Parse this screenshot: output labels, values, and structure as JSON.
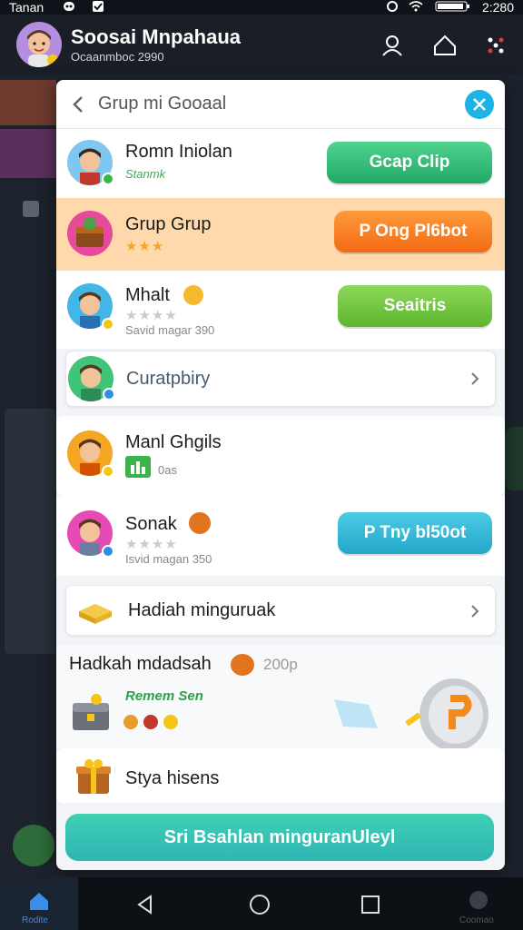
{
  "status_bar": {
    "carrier": "Tanan",
    "time": "2:280"
  },
  "header": {
    "app_title": "Soosai Mnpahaua",
    "subtitle": "Ocaanmboc 2990",
    "icons": [
      "user-icon",
      "home-icon",
      "more-dots-icon"
    ]
  },
  "modal": {
    "title": "Grup mi Gooaal",
    "rows": [
      {
        "name": "Romn Iniolan",
        "sub": "Stanmk",
        "button": "Gcap Clip"
      },
      {
        "name": "Grup Grup",
        "stars": "★★★",
        "button": "P Ong Pl6bot"
      },
      {
        "name": "Mhalt",
        "stars": "★★★★",
        "sub": "Savid magar 390",
        "button": "Seaitris"
      },
      {
        "name": "Curatpbiry"
      },
      {
        "name": "Manl Ghgils",
        "sub": "0as"
      },
      {
        "name": "Sonak",
        "stars": "★★★★",
        "sub": "Isvid magan 350",
        "button": "P Tny bl50ot"
      }
    ],
    "gift_card": {
      "label": "Hadiah minguruak"
    },
    "reward": {
      "title": "Hadkah mdadsah",
      "amount": "200p",
      "green_text": "Remem Sen"
    },
    "bottom_item": {
      "label": "Stya hisens"
    },
    "footer_button": "Sri Bsahlan minguranUleyl"
  },
  "navbar": {
    "left_label": "Rodite",
    "right_label": "Coomao"
  },
  "colors": {
    "accent": "#1eb3e6",
    "highlight_row": "#ffd9ab",
    "footer": "#2fb5b4"
  }
}
